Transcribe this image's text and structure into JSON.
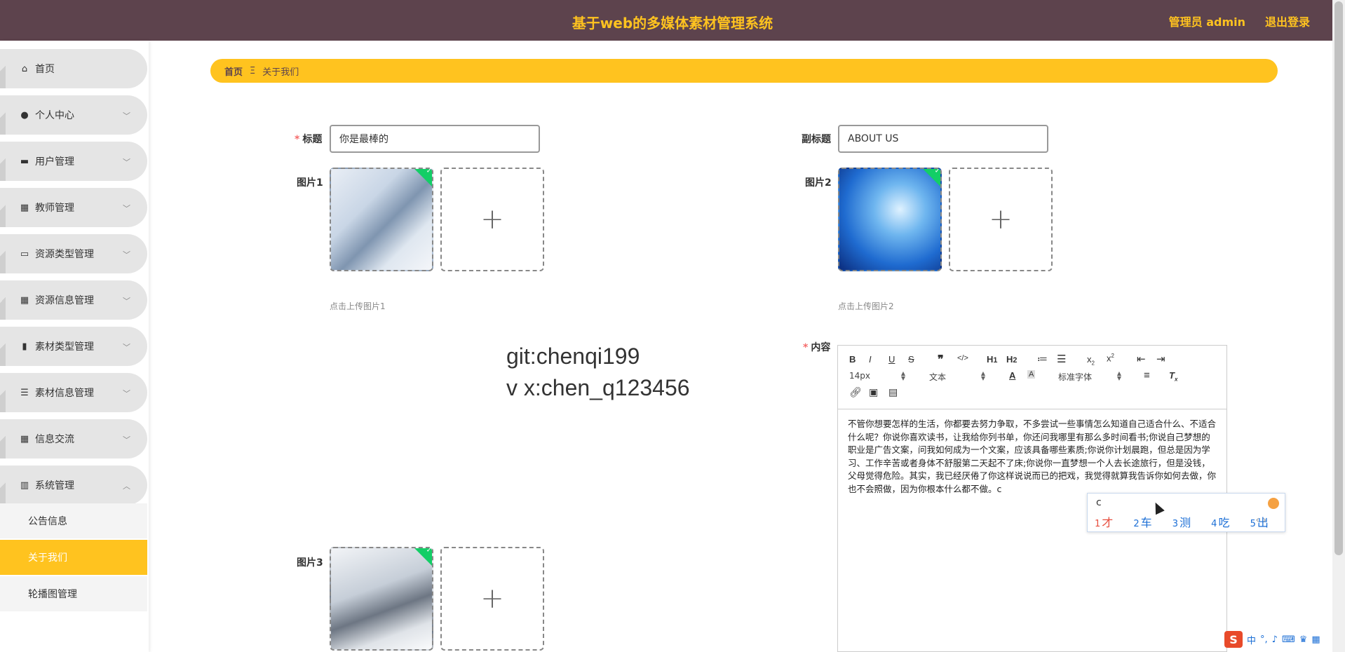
{
  "header": {
    "title": "基于web的多媒体素材管理系统",
    "user": "管理员 admin",
    "logout": "退出登录"
  },
  "sidebar": {
    "items": [
      {
        "label": "首页",
        "icon": "home-icon"
      },
      {
        "label": "个人中心",
        "icon": "user-icon"
      },
      {
        "label": "用户管理",
        "icon": "chat-icon"
      },
      {
        "label": "教师管理",
        "icon": "grid-icon"
      },
      {
        "label": "资源类型管理",
        "icon": "briefcase-icon"
      },
      {
        "label": "资源信息管理",
        "icon": "grid-icon"
      },
      {
        "label": "素材类型管理",
        "icon": "bar-chart-icon"
      },
      {
        "label": "素材信息管理",
        "icon": "sliders-icon"
      },
      {
        "label": "信息交流",
        "icon": "grid-icon"
      },
      {
        "label": "系统管理",
        "icon": "building-icon"
      }
    ],
    "subitems": [
      {
        "label": "公告信息"
      },
      {
        "label": "关于我们"
      },
      {
        "label": "轮播图管理"
      }
    ]
  },
  "breadcrumb": {
    "home": "首页",
    "sep": "Ξ",
    "current": "关于我们"
  },
  "form": {
    "title_label": "标题",
    "title_value": "你是最棒的",
    "subtitle_label": "副标题",
    "subtitle_value": "ABOUT US",
    "img1_label": "图片1",
    "img1_tip": "点击上传图片1",
    "img2_label": "图片2",
    "img2_tip": "点击上传图片2",
    "img3_label": "图片3",
    "content_label": "内容",
    "plus": "+"
  },
  "watermark": {
    "line1": "git:chenqi199",
    "line2": "v x:chen_q123456"
  },
  "editor": {
    "font_size": "14px",
    "heading": "文本",
    "font_family": "标准字体",
    "content": "不管你想要怎样的生活，你都要去努力争取，不多尝试一些事情怎么知道自己适合什么、不适合什么呢？你说你喜欢读书，让我给你列书单，你还问我哪里有那么多时间看书;你说自己梦想的职业是广告文案，问我如何成为一个文案，应该具备哪些素质;你说你计划晨跑，但总是因为学习、工作辛苦或者身体不舒服第二天起不了床;你说你一直梦想一个人去长途旅行，但是没钱，父母觉得危险。其实，我已经厌倦了你这样说说而已的把戏，我觉得就算我告诉你如何去做，你也不会照做，因为你根本什么都不做。c"
  },
  "ime": {
    "typed": "c",
    "candidates": [
      {
        "num": "1",
        "text": "才"
      },
      {
        "num": "2",
        "text": "车"
      },
      {
        "num": "3",
        "text": "测"
      },
      {
        "num": "4",
        "text": "吃"
      },
      {
        "num": "5",
        "text": "出"
      }
    ],
    "nav": "‹ ›"
  },
  "tray": {
    "logo": "S",
    "lang": "中"
  }
}
